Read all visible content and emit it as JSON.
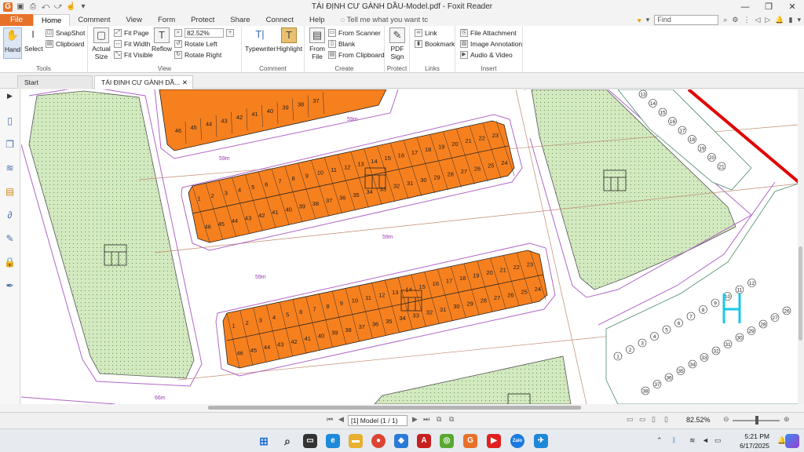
{
  "window": {
    "title": "TÁI ĐỊNH CƯ GÀNH DẦU-Model.pdf - Foxit Reader",
    "min": "—",
    "restore": "❐",
    "close": "✕"
  },
  "quick_access": [
    "G",
    "▣",
    "⎙",
    "⤺",
    "⤻",
    "☝",
    "▾"
  ],
  "menu": {
    "file": "File",
    "tabs": [
      "Home",
      "Comment",
      "View",
      "Form",
      "Protect",
      "Share",
      "Connect",
      "Help"
    ],
    "tellme": "Tell me what you want tc",
    "find_placeholder": "Find"
  },
  "ribbon": {
    "tools": {
      "label": "Tools",
      "hand": "Hand",
      "select": "Select",
      "snapshot": "SnapShot",
      "clipboard": "Clipboard"
    },
    "view": {
      "label": "View",
      "actual_size_1": "Actual",
      "actual_size_2": "Size",
      "fit_page": "Fit Page",
      "fit_width": "Fit Width",
      "fit_visible": "Fit Visible",
      "reflow": "Reflow",
      "zoom": "82.52%",
      "rotate_left": "Rotate Left",
      "rotate_right": "Rotate Right"
    },
    "comment": {
      "label": "Comment",
      "typewriter": "Typewriter",
      "highlight": "Highlight"
    },
    "create": {
      "label": "Create",
      "from_file_1": "From",
      "from_file_2": "File",
      "from_scanner": "From Scanner",
      "blank": "Blank",
      "from_clipboard": "From Clipboard"
    },
    "protect": {
      "label": "Protect",
      "pdf_sign_1": "PDF",
      "pdf_sign_2": "Sign"
    },
    "links": {
      "label": "Links",
      "link": "Link",
      "bookmark": "Bookmark"
    },
    "insert": {
      "label": "Insert",
      "file_attachment": "File Attachment",
      "image_annotation": "Image Annotation",
      "audio_video": "Audio & Video"
    }
  },
  "doc_tabs": {
    "start": "Start",
    "doc": "TÁI ĐỊNH CƯ GÀNH DẦ...",
    "close": "✕"
  },
  "map": {
    "block1_top": [
      "1",
      "2",
      "3",
      "4",
      "5",
      "6",
      "7",
      "8",
      "9",
      "10",
      "11",
      "12",
      "13",
      "14",
      "15",
      "16",
      "17",
      "18",
      "19",
      "20",
      "21",
      "22",
      "23"
    ],
    "block1_bottom": [
      "46",
      "45",
      "44",
      "43",
      "42",
      "41",
      "40",
      "39",
      "38",
      "37",
      "36",
      "35",
      "34",
      "33",
      "32",
      "31",
      "30",
      "29",
      "28",
      "27",
      "26",
      "25",
      "24"
    ],
    "block0_bottom": [
      "46",
      "45",
      "44",
      "43",
      "42",
      "41",
      "40",
      "39",
      "38",
      "37"
    ],
    "dim_59m": "59m",
    "dim_66m": "66m",
    "right_upper": [
      "13",
      "14",
      "15",
      "16",
      "17",
      "18",
      "19",
      "20",
      "21"
    ],
    "right_lower": [
      "1",
      "2",
      "3",
      "4",
      "5",
      "6",
      "7",
      "8",
      "9",
      "10",
      "11",
      "12",
      "26",
      "27",
      "28",
      "29",
      "30",
      "31",
      "32",
      "33",
      "34",
      "35",
      "36",
      "37",
      "38"
    ]
  },
  "status": {
    "page": "[1] Model (1 / 1)",
    "zoom": "82.52%"
  },
  "taskbar": {
    "time": "5:21 PM",
    "date": "6/17/2025"
  },
  "colors": {
    "accent": "#e8712a",
    "lot": "#f7801e",
    "green": "#c9e4b2",
    "road": "#9a3bb0",
    "red": "#e00000",
    "cyan": "#17c8e8"
  }
}
